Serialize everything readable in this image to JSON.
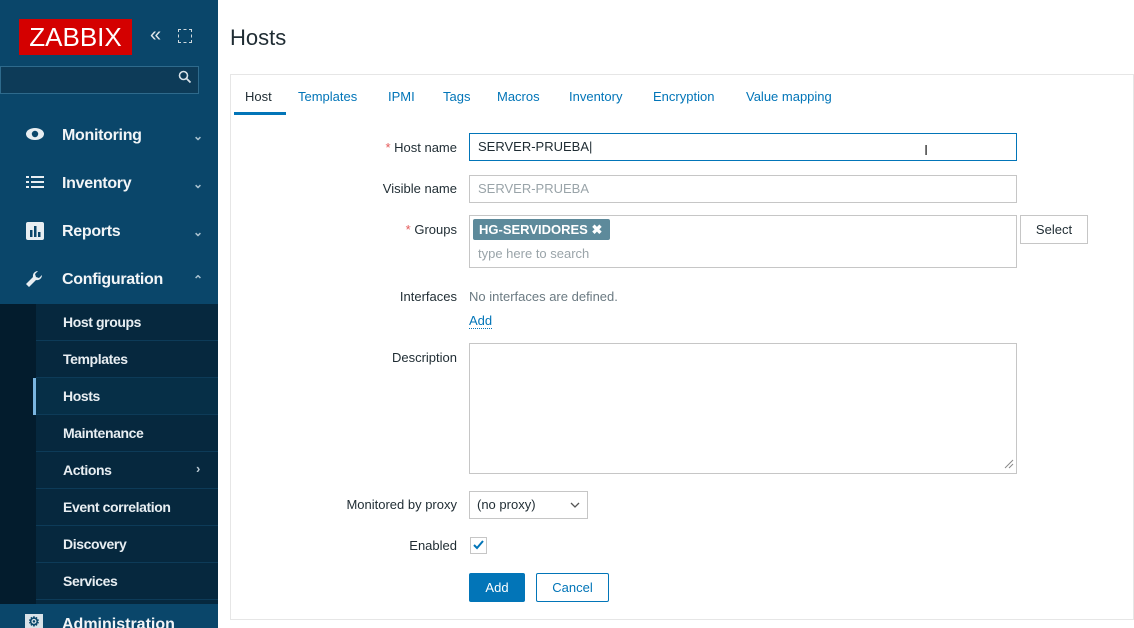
{
  "brand": {
    "logo": "ZABBIX",
    "logo_color": "#d40000",
    "sidebar_color": "#0a466a"
  },
  "sidebar": {
    "collapse_icon": "«",
    "search_placeholder": "",
    "menu": [
      {
        "label": "Monitoring",
        "icon": "eye-icon",
        "chevron": "⌄"
      },
      {
        "label": "Inventory",
        "icon": "list-icon",
        "chevron": "⌄"
      },
      {
        "label": "Reports",
        "icon": "bar-chart-icon",
        "chevron": "⌄"
      },
      {
        "label": "Configuration",
        "icon": "wrench-icon",
        "chevron": "⌃"
      }
    ],
    "submenu": [
      {
        "label": "Host groups"
      },
      {
        "label": "Templates"
      },
      {
        "label": "Hosts"
      },
      {
        "label": "Maintenance"
      },
      {
        "label": "Actions",
        "chevron": "›"
      },
      {
        "label": "Event correlation"
      },
      {
        "label": "Discovery"
      },
      {
        "label": "Services"
      }
    ],
    "admin_label": "Administration"
  },
  "page": {
    "title": "Hosts"
  },
  "tabs": [
    "Host",
    "Templates",
    "IPMI",
    "Tags",
    "Macros",
    "Inventory",
    "Encryption",
    "Value mapping"
  ],
  "form": {
    "required_mark": "*",
    "host_name_label": "Host name",
    "host_name_value": "SERVER-PRUEBA",
    "visible_name_label": "Visible name",
    "visible_name_placeholder": "SERVER-PRUEBA",
    "groups_label": "Groups",
    "group_chip": "HG-SERVIDORES",
    "group_chip_remove": "✖",
    "groups_placeholder": "type here to search",
    "select_button": "Select",
    "interfaces_label": "Interfaces",
    "interfaces_text": "No interfaces are defined.",
    "interfaces_add": "Add",
    "description_label": "Description",
    "description_value": "",
    "proxy_label": "Monitored by proxy",
    "proxy_value": "(no proxy)",
    "enabled_label": "Enabled",
    "enabled_checked": true,
    "add_button": "Add",
    "cancel_button": "Cancel"
  }
}
